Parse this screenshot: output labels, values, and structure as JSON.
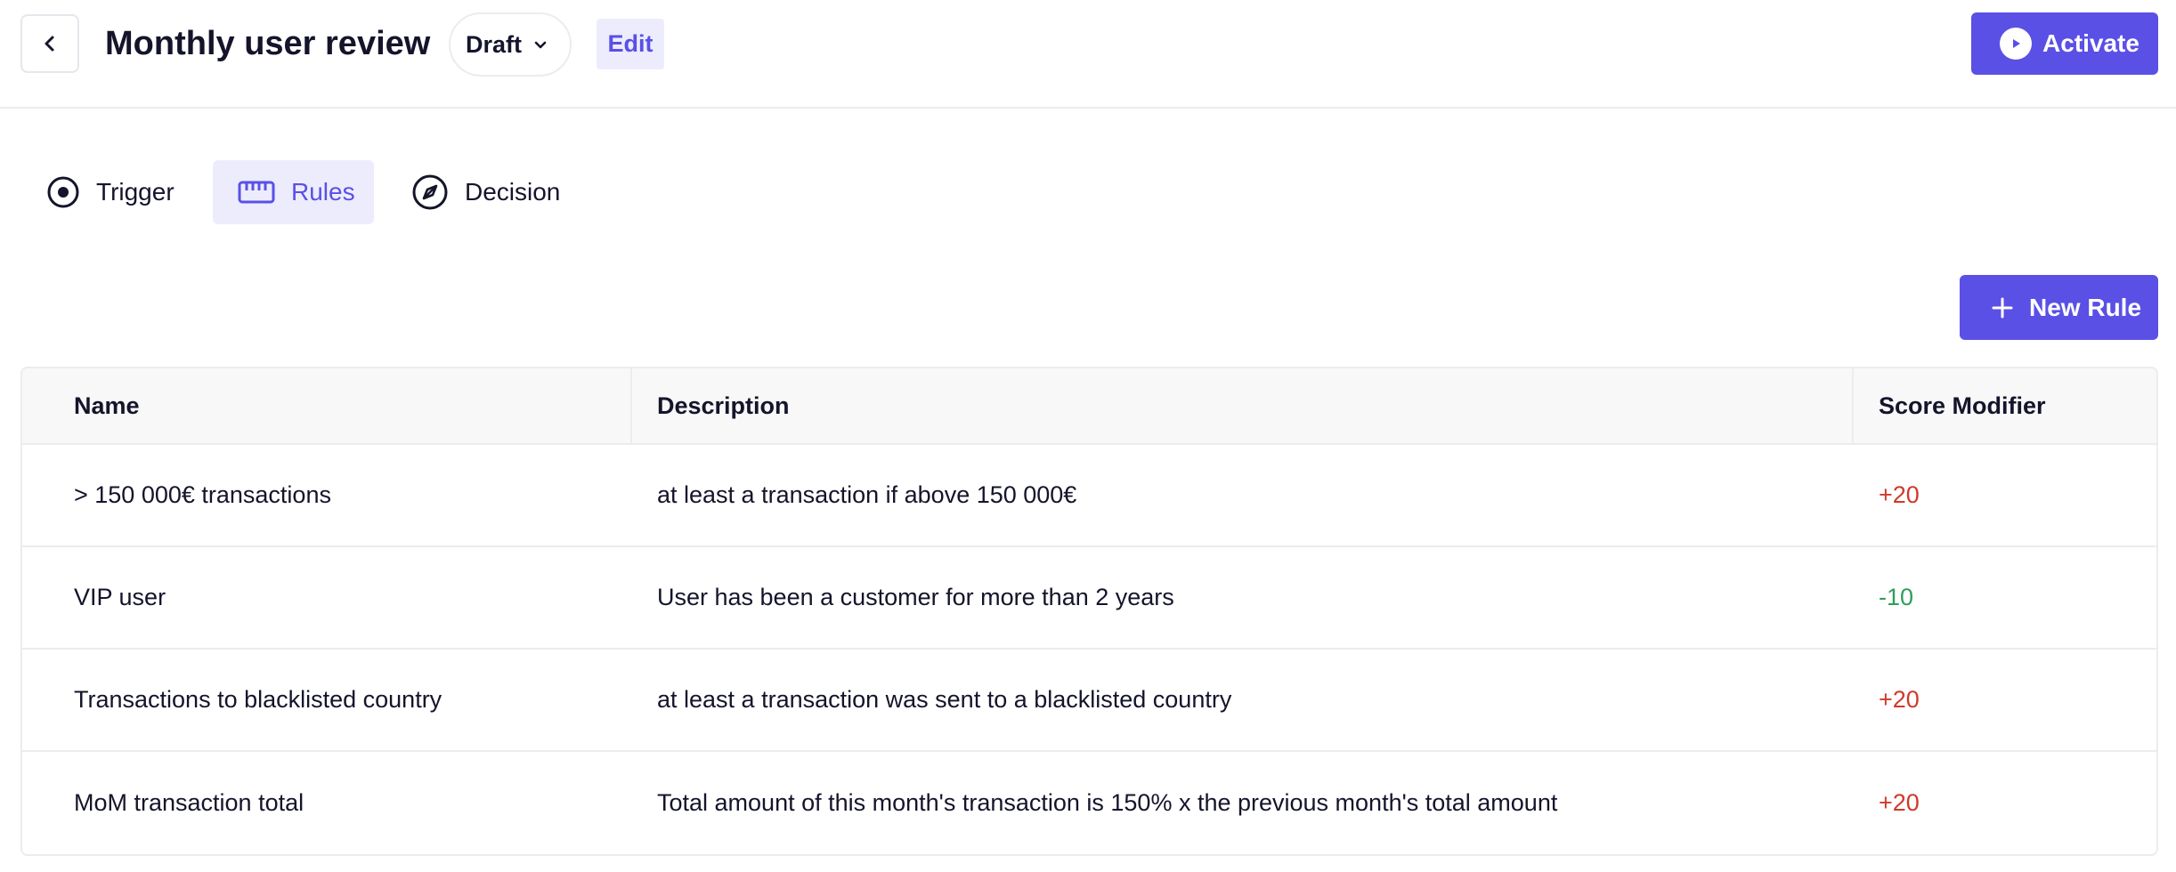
{
  "header": {
    "title": "Monthly user review",
    "status": "Draft",
    "edit_label": "Edit",
    "activate_label": "Activate"
  },
  "tabs": [
    {
      "label": "Trigger",
      "icon": "target-icon",
      "active": false
    },
    {
      "label": "Rules",
      "icon": "ruler-icon",
      "active": true
    },
    {
      "label": "Decision",
      "icon": "compass-icon",
      "active": false
    }
  ],
  "new_rule_label": "New Rule",
  "table": {
    "columns": [
      "Name",
      "Description",
      "Score Modifier"
    ],
    "rows": [
      {
        "name": "> 150 000€ transactions",
        "description": "at least a transaction if above 150 000€",
        "score": "+20"
      },
      {
        "name": "VIP user",
        "description": "User has been a customer for more than 2 years",
        "score": "-10"
      },
      {
        "name": "Transactions to blacklisted country",
        "description": "at least a transaction was sent to a blacklisted country",
        "score": "+20"
      },
      {
        "name": "MoM transaction total",
        "description": "Total amount of this month's transaction is 150% x the previous month's total amount",
        "score": "+20"
      }
    ]
  },
  "colors": {
    "accent": "#5a50e6",
    "accent_light": "#ececfd",
    "score_positive": "#d0392b",
    "score_negative": "#2f9e5a"
  }
}
